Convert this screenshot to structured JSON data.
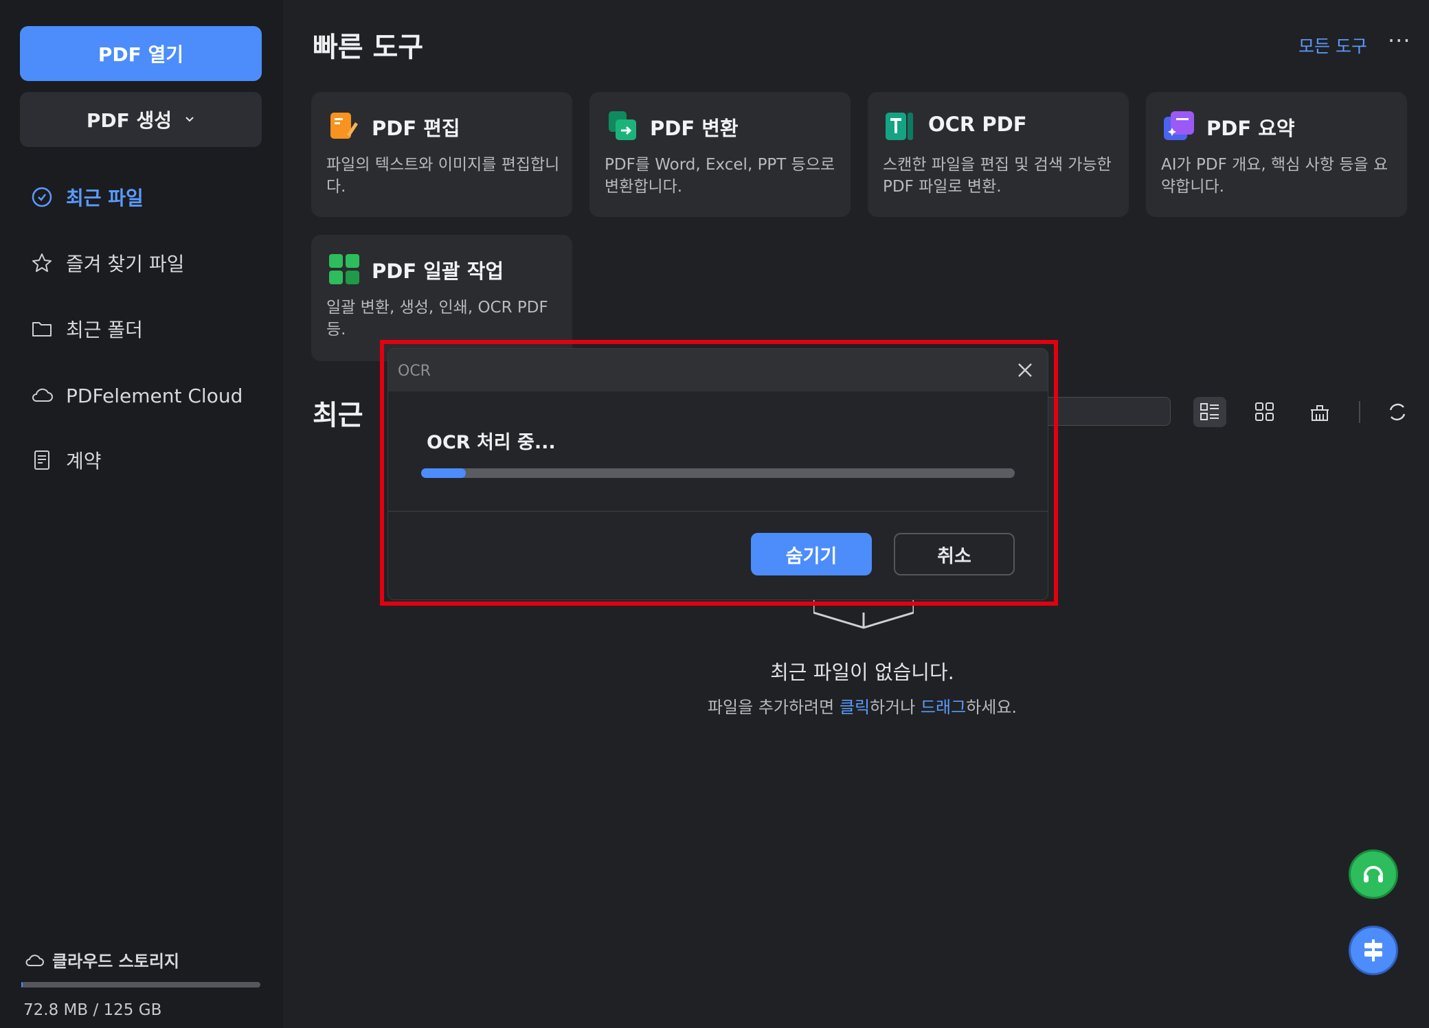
{
  "sidebar": {
    "open_pdf_label": "PDF 열기",
    "create_pdf_label": "PDF 생성",
    "nav": [
      {
        "label": "최근 파일",
        "icon": "clock-icon",
        "active": true
      },
      {
        "label": "즐겨 찾기 파일",
        "icon": "star-icon",
        "active": false
      },
      {
        "label": "최근 폴더",
        "icon": "folder-icon",
        "active": false
      },
      {
        "label": "PDFelement Cloud",
        "icon": "cloud-icon",
        "active": false
      },
      {
        "label": "계약",
        "icon": "document-icon",
        "active": false
      }
    ],
    "storage": {
      "label": "클라우드 스토리지",
      "used": "72.8 MB",
      "separator": "/",
      "total": "125 GB",
      "used_fraction": 0.0006
    }
  },
  "quick_tools": {
    "title": "빠른 도구",
    "all_tools_label": "모든 도구",
    "more_icon": "more-horizontal-icon",
    "cards": [
      {
        "title": "PDF 편집",
        "desc": "파일의 텍스트와 이미지를 편집합니다.",
        "icon": "edit-pdf-icon",
        "color": "#f7931e"
      },
      {
        "title": "PDF 변환",
        "desc": "PDF를 Word, Excel, PPT 등으로 변환합니다.",
        "icon": "convert-pdf-icon",
        "color": "#1cb37a"
      },
      {
        "title": "OCR PDF",
        "desc": "스캔한 파일을 편집 및 검색 가능한 PDF 파일로 변환.",
        "icon": "ocr-pdf-icon",
        "color": "#16a383"
      },
      {
        "title": "PDF 요약",
        "desc": "AI가 PDF 개요, 핵심 사항 등을 요약합니다.",
        "icon": "summarize-pdf-icon",
        "color": "#7b5cf5"
      },
      {
        "title": "PDF 일괄 작업",
        "desc": "일괄 변환, 생성, 인쇄, OCR PDF 등.",
        "icon": "batch-pdf-icon",
        "color": "#2ebd5c"
      }
    ]
  },
  "recent": {
    "title_visible": "최근",
    "empty_title": "최근 파일이 없습니다.",
    "empty_sub_prefix": "파일을 추가하려면 ",
    "empty_sub_click": "클릭",
    "empty_sub_middle": "하거나 ",
    "empty_sub_drag": "드래그",
    "empty_sub_suffix": "하세요."
  },
  "dialog": {
    "title": "OCR",
    "status": "OCR 처리 중...",
    "progress_fraction": 0.075,
    "hide_label": "숨기기",
    "cancel_label": "취소"
  },
  "colors": {
    "accent": "#4c8dfb",
    "highlight_border": "#e3000f"
  }
}
